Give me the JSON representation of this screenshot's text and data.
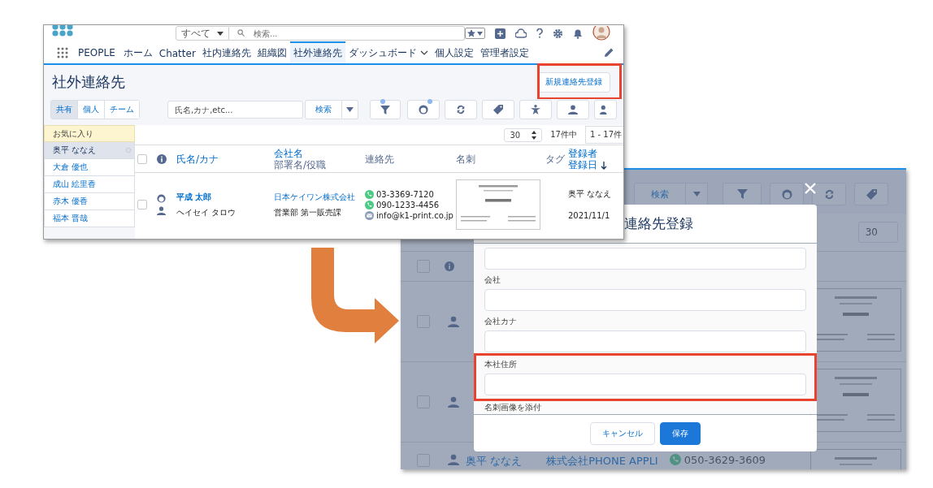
{
  "list_screen": {
    "global_header": {
      "scope": "すべて",
      "search_placeholder": "検索..."
    },
    "app_name": "PEOPLE",
    "nav_tabs": [
      {
        "label": "ホーム",
        "selected": false,
        "has_menu": false
      },
      {
        "label": "Chatter",
        "selected": false,
        "has_menu": false
      },
      {
        "label": "社内連絡先",
        "selected": false,
        "has_menu": false
      },
      {
        "label": "組織図",
        "selected": false,
        "has_menu": false
      },
      {
        "label": "社外連絡先",
        "selected": true,
        "has_menu": false
      },
      {
        "label": "ダッシュボード",
        "selected": false,
        "has_menu": true
      },
      {
        "label": "個人設定",
        "selected": false,
        "has_menu": false
      },
      {
        "label": "管理者設定",
        "selected": false,
        "has_menu": false
      }
    ],
    "page_title": "社外連絡先",
    "new_button": {
      "label": "新規連絡先登録",
      "highlighted": true
    },
    "scope_tabs": [
      {
        "label": "共有",
        "selected": true
      },
      {
        "label": "個人",
        "selected": false
      },
      {
        "label": "チーム",
        "selected": false
      }
    ],
    "search": {
      "placeholder": "氏名,カナ,etc...",
      "button": "検索"
    },
    "favorites": {
      "title": "お気に入り",
      "items": [
        {
          "name": "奥平 ななえ",
          "selected": true
        },
        {
          "name": "大倉 優也",
          "selected": false
        },
        {
          "name": "成山 絵里香",
          "selected": false
        },
        {
          "name": "赤木 優香",
          "selected": false
        },
        {
          "name": "福本 晋哉",
          "selected": false
        }
      ]
    },
    "pager": {
      "page_size": "30",
      "total": "17件中",
      "range": "1 - 17件"
    },
    "columns": [
      {
        "kind": "checkbox",
        "checked": false
      },
      {
        "kind": "info"
      },
      {
        "kind": "text",
        "lines": [
          {
            "text": "氏名/カナ",
            "link": true
          }
        ]
      },
      {
        "kind": "text",
        "lines": [
          {
            "text": "会社名",
            "link": true
          },
          {
            "text": "部署名/役職",
            "link": false
          }
        ]
      },
      {
        "kind": "text",
        "lines": [
          {
            "text": "連絡先",
            "link": false
          }
        ]
      },
      {
        "kind": "text",
        "lines": [
          {
            "text": "名刺",
            "link": false
          }
        ]
      },
      {
        "kind": "text",
        "lines": [
          {
            "text": "タグ",
            "link": false
          }
        ]
      },
      {
        "kind": "text",
        "lines": [
          {
            "text": "登録者",
            "link": true
          },
          {
            "text": "登録日",
            "link": true
          }
        ],
        "sorted": true
      }
    ],
    "rows": [
      {
        "checked": false,
        "name": "平成 太郎",
        "kana": "ヘイセイ タロウ",
        "company": "日本ケイワン株式会社",
        "department": "営業部 第一販売課",
        "contacts": [
          {
            "kind": "phone",
            "value": "03-3369-7120"
          },
          {
            "kind": "phone",
            "value": "090-1233-4456"
          },
          {
            "kind": "email",
            "value": "info@k1-print.co.jp"
          }
        ],
        "registrant": "奥平 ななえ",
        "date": "2021/11/1"
      }
    ]
  },
  "dialog_screen": {
    "background": {
      "search_button": "検索",
      "page_size": "30",
      "header_checked": false,
      "rows": [
        {
          "checked": false
        },
        {
          "checked": false
        },
        {
          "checked": false,
          "name": "奥平 ななえ",
          "company": "株式会社PHONE APPLI",
          "phone": "050-3629-3609"
        }
      ]
    },
    "dialog": {
      "title": "連絡先登録",
      "fields": [
        {
          "highlighted": false
        },
        {
          "label": "会社",
          "highlighted": false
        },
        {
          "label": "会社カナ",
          "highlighted": false
        },
        {
          "label": "本社住所",
          "highlighted": true
        }
      ],
      "cut_label": "名刺画像を添付",
      "buttons": [
        {
          "label": "キャンセル",
          "kind": "secondary"
        },
        {
          "label": "保存",
          "kind": "primary"
        }
      ]
    }
  }
}
